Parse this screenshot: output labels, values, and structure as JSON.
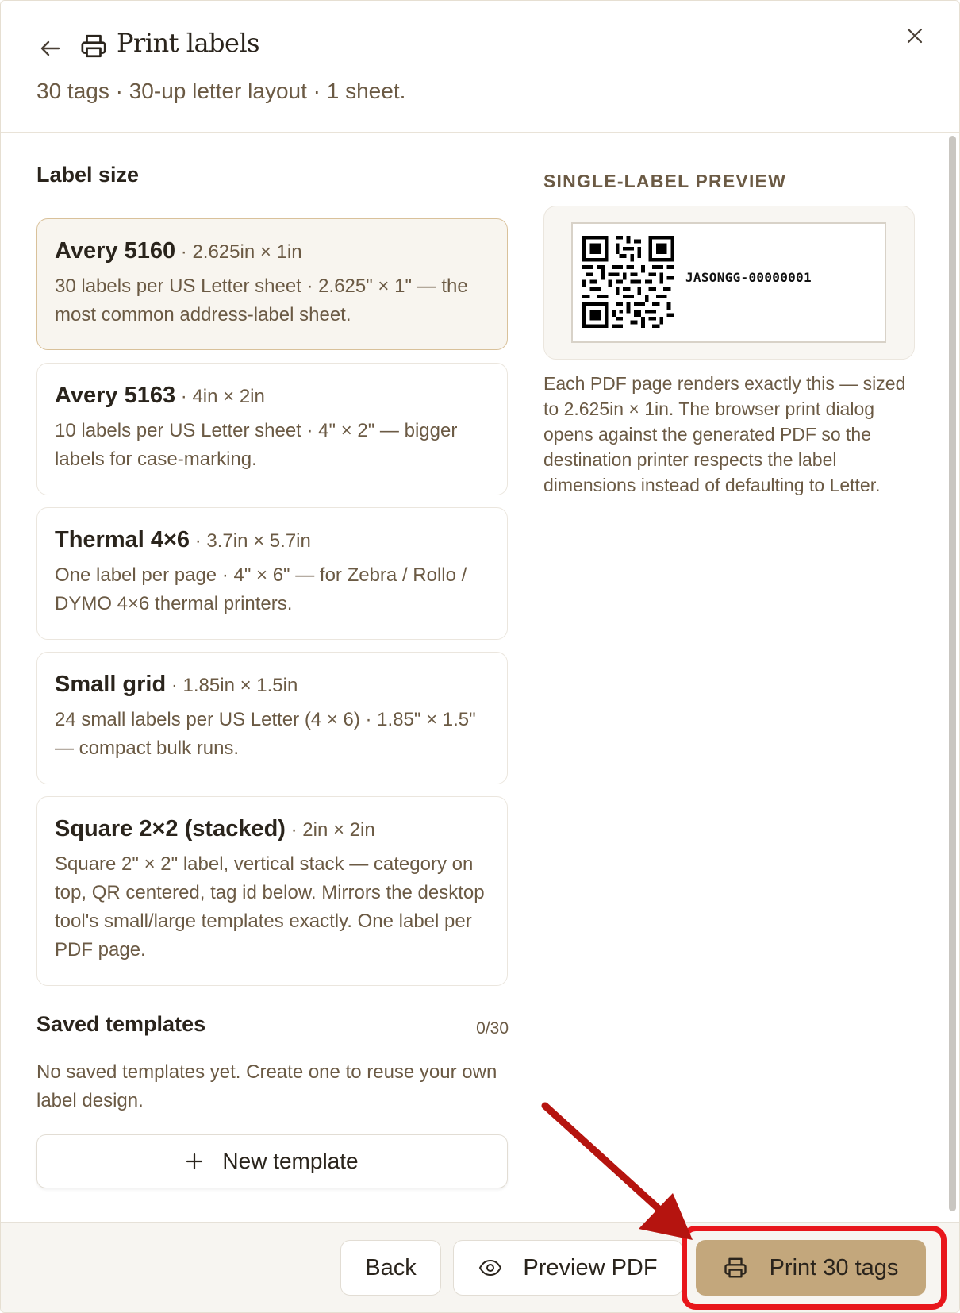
{
  "header": {
    "title": "Print labels",
    "subtitle": "30 tags · 30-up letter layout · 1 sheet."
  },
  "label_size": {
    "heading": "Label size",
    "options": [
      {
        "name": "Avery 5160",
        "dims": " · 2.625in × 1in",
        "desc": "30 labels per US Letter sheet · 2.625\" × 1\" — the most common address-label sheet.",
        "selected": true
      },
      {
        "name": "Avery 5163",
        "dims": " · 4in × 2in",
        "desc": "10 labels per US Letter sheet · 4\" × 2\" — bigger labels for case-marking.",
        "selected": false
      },
      {
        "name": "Thermal 4×6",
        "dims": " · 3.7in × 5.7in",
        "desc": "One label per page · 4\" × 6\" — for Zebra / Rollo / DYMO 4×6 thermal printers.",
        "selected": false
      },
      {
        "name": "Small grid",
        "dims": " · 1.85in × 1.5in",
        "desc": "24 small labels per US Letter (4 × 6) · 1.85\" × 1.5\" — compact bulk runs.",
        "selected": false
      },
      {
        "name": "Square 2×2 (stacked)",
        "dims": " · 2in × 2in",
        "desc": "Square 2\" × 2\" label, vertical stack — category on top, QR centered, tag id below. Mirrors the desktop tool's small/large templates exactly. One label per PDF page.",
        "selected": false
      }
    ]
  },
  "saved_templates": {
    "heading": "Saved templates",
    "count": "0/30",
    "empty_text": "No saved templates yet. Create one to reuse your own label design.",
    "new_button": "New template"
  },
  "preview": {
    "heading": "SINGLE-LABEL PREVIEW",
    "tag_id": "JASONGG-00000001",
    "note": "Each PDF page renders exactly this — sized to 2.625in × 1in. The browser print dialog opens against the generated PDF so the destination printer respects the label dimensions instead of defaulting to Letter."
  },
  "footer": {
    "back_label": "Back",
    "preview_label": "Preview PDF",
    "print_label": "Print 30 tags"
  },
  "colors": {
    "accent": "#c3a77c",
    "annotation": "#e8161b",
    "arrow": "#b5140f"
  }
}
